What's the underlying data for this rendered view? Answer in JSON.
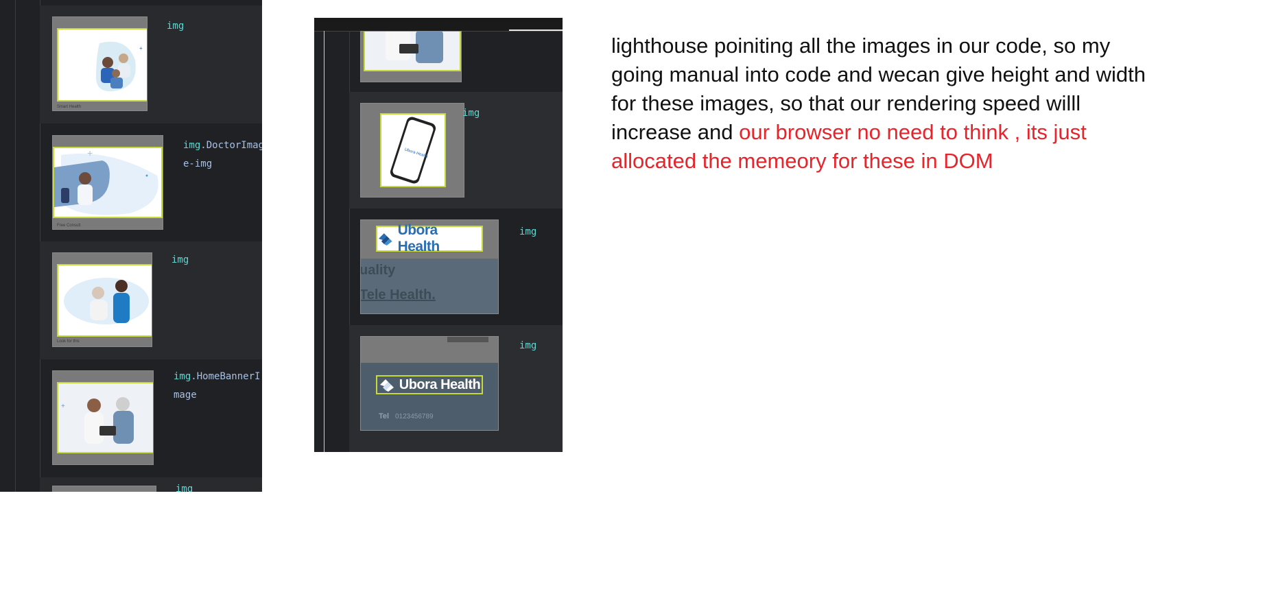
{
  "left_panel": {
    "rows": [
      {
        "label_tag": "img",
        "label_class": "",
        "caption": "Smart Health"
      },
      {
        "label_tag": "img",
        "label_class": ".DoctorImag\ne-img",
        "caption": "Free Consult"
      },
      {
        "label_tag": "img",
        "label_class": "",
        "caption": "Look for this"
      },
      {
        "label_tag": "img",
        "label_class": ".HomeBannerI\nmage",
        "caption": ""
      },
      {
        "label_tag": "img",
        "label_class": "",
        "caption": ""
      }
    ]
  },
  "middle_panel": {
    "rows": [
      {
        "label": ""
      },
      {
        "label": "img",
        "phone_text": "Ubora Health"
      },
      {
        "label": "img",
        "logo_text": "Ubora Health",
        "overlay_line1": "uality",
        "overlay_line2": "Tele Health."
      },
      {
        "label": "img",
        "logo_text": "Ubora Health",
        "footer_label": "Tel",
        "footer_value": "0123456789"
      }
    ]
  },
  "note": {
    "text_black": "lighthouse poiniting all the images in our code, so my going manual into code and wecan give height and width for these images, so that our rendering speed willl increase and ",
    "text_red": "our browser no need to think , its just allocated the memeory for these in DOM"
  },
  "colors": {
    "panel_bg": "#202124",
    "tag_color": "#5ed8d3",
    "class_color": "#a7c1e6",
    "highlight_border": "#c8da3a",
    "note_red": "#e8232a",
    "brand_blue": "#2a6db5"
  }
}
